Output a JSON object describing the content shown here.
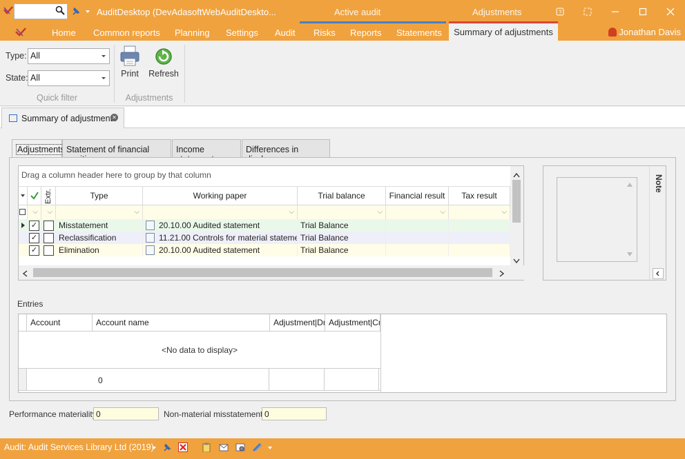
{
  "titlebar": {
    "app_title": "AuditDesktop (DevAdasoftWebAuditDeskto...",
    "context_active": "Active audit",
    "context_adjustments": "Adjustments",
    "search_value": ""
  },
  "ribbon_tabs": [
    "Home",
    "Common reports",
    "Planning",
    "Settings",
    "Audit",
    "Risks",
    "Reports",
    "Statements",
    "Summary of adjustments"
  ],
  "user": {
    "name": "Jonathan Davis"
  },
  "quick_filter": {
    "type_label": "Type:",
    "type_value": "All",
    "state_label": "State:",
    "state_value": "All",
    "group_label": "Quick filter"
  },
  "adjustments_group": {
    "print_label": "Print",
    "refresh_label": "Refresh",
    "group_label": "Adjustments"
  },
  "doc_tab": {
    "label": "Summary of adjustments"
  },
  "inner_tabs": [
    "Adjustments",
    "Statement of financial position",
    "Income statement",
    "Differences in disclosure"
  ],
  "grid": {
    "group_hint": "Drag a column header here to group by that column",
    "extr_header": "Extr.",
    "columns": [
      "Type",
      "Working paper",
      "Trial balance",
      "Financial result",
      "Tax result"
    ],
    "rows": [
      {
        "type": "Misstatement",
        "working_paper": "20.10.00 Audited statement",
        "trial_balance": "Trial Balance",
        "checked": true,
        "extr": false
      },
      {
        "type": "Reclassification",
        "working_paper": "11.21.00 Controls for material stateme...",
        "trial_balance": "Trial Balance",
        "checked": true,
        "extr": false
      },
      {
        "type": "Elimination",
        "working_paper": "20.10.00 Audited statement",
        "trial_balance": "Trial Balance",
        "checked": true,
        "extr": false
      }
    ]
  },
  "note_panel": {
    "label": "Note"
  },
  "entries": {
    "label": "Entries",
    "columns": [
      "Account",
      "Account name",
      "Adjustment|Dr",
      "Adjustment|Cr"
    ],
    "no_data": "<No data to display>",
    "footer_value": "0"
  },
  "bottom": {
    "performance_label": "Performance materiality",
    "performance_value": "0",
    "nonmaterial_label": "Non-material misstatements",
    "nonmaterial_value": "0"
  },
  "status": {
    "text": "Audit: Audit Services Library Ltd (2019)"
  },
  "colors": {
    "accent": "#f0a23e",
    "filter_row": "#fffde7",
    "row1": "#eaf8ea",
    "row2": "#efeffa",
    "row3": "#fffde7"
  }
}
